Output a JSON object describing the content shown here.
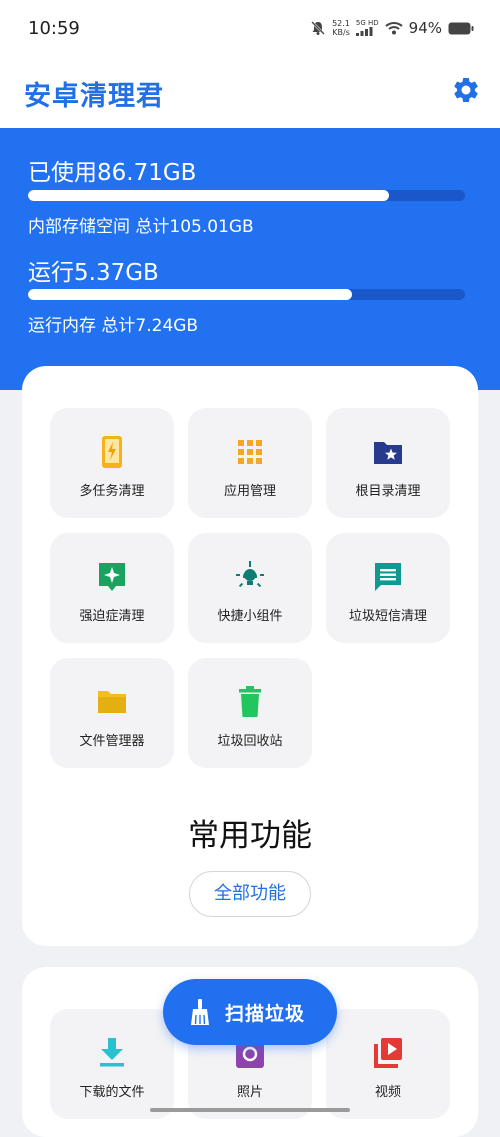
{
  "status_bar": {
    "time": "10:59",
    "net_speed_value": "52.1",
    "net_speed_unit": "KB/s",
    "signal_label": "5G HD",
    "battery_percent": "94%"
  },
  "app": {
    "title": "安卓清理君"
  },
  "storage": {
    "used_label": "已使用86.71GB",
    "detail": "内部存储空间 总计105.01GB",
    "fill_fraction": 0.826
  },
  "memory": {
    "used_label": "运行5.37GB",
    "detail": "运行内存 总计7.24GB",
    "fill_fraction": 0.742
  },
  "features": {
    "title": "常用功能",
    "all_button": "全部功能",
    "items": [
      {
        "label": "多任务清理",
        "icon": "phone-charge-icon",
        "color": "#f5b21b"
      },
      {
        "label": "应用管理",
        "icon": "grid-apps-icon",
        "color": "#f5a623"
      },
      {
        "label": "根目录清理",
        "icon": "star-folder-icon",
        "color": "#283a8e"
      },
      {
        "label": "强迫症清理",
        "icon": "sparkle-badge-icon",
        "color": "#1aa260"
      },
      {
        "label": "快捷小组件",
        "icon": "lamp-icon",
        "color": "#0e7c72"
      },
      {
        "label": "垃圾短信清理",
        "icon": "message-icon",
        "color": "#0e9a91"
      },
      {
        "label": "文件管理器",
        "icon": "folder-icon",
        "color": "#f2c018"
      },
      {
        "label": "垃圾回收站",
        "icon": "trash-icon",
        "color": "#22c55e"
      }
    ]
  },
  "media": {
    "items": [
      {
        "label": "下载的文件",
        "icon": "download-icon",
        "color": "#2bc0cf"
      },
      {
        "label": "照片",
        "icon": "photo-icon",
        "color": "#8e44ad"
      },
      {
        "label": "视频",
        "icon": "video-icon",
        "color": "#e53935"
      }
    ]
  },
  "fab": {
    "label": "扫描垃圾",
    "icon": "broom-icon"
  }
}
